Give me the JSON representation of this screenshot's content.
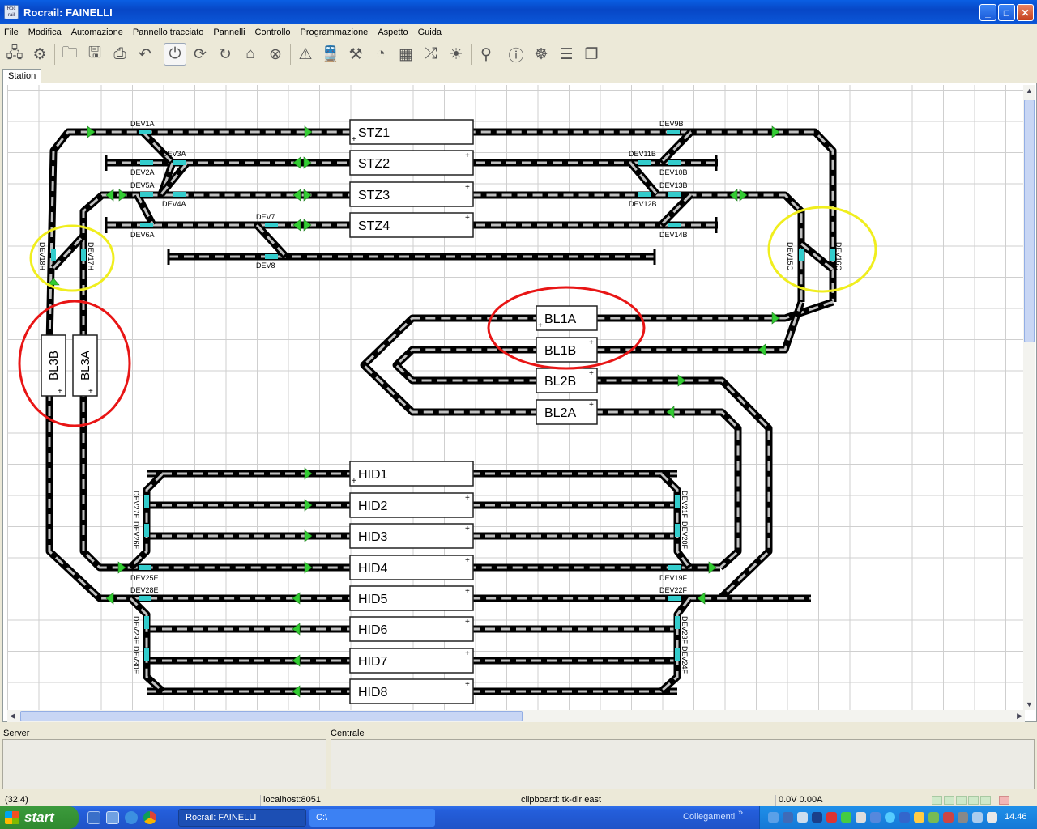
{
  "window": {
    "title": "Rocrail: FAINELLI",
    "app_icon_text": "Roc rail"
  },
  "menu": [
    "File",
    "Modifica",
    "Automazione",
    "Pannello tracciato",
    "Pannelli",
    "Controllo",
    "Programmazione",
    "Aspetto",
    "Guida"
  ],
  "toolbar": {
    "icons": [
      "server-icon",
      "gear-icon",
      "|",
      "open-folder-icon",
      "save-icon",
      "print-icon",
      "undo-icon",
      "|",
      "power-icon",
      "sync-icon",
      "rotate-icon",
      "home-icon",
      "stop-icon",
      "|",
      "warning-icon",
      "locomotive-icon",
      "tools-icon",
      "throttle-icon",
      "switchboard-icon",
      "shuffle-icon",
      "light-icon",
      "|",
      "search-icon",
      "|",
      "info-icon",
      "bug-icon",
      "list-icon",
      "pages-icon"
    ]
  },
  "tabs": [
    {
      "label": "Station"
    }
  ],
  "plan": {
    "stations": [
      "STZ1",
      "STZ2",
      "STZ3",
      "STZ4"
    ],
    "blocks": [
      "BL1A",
      "BL1B",
      "BL2B",
      "BL2A",
      "BL3B",
      "BL3A"
    ],
    "hidden": [
      "HID1",
      "HID2",
      "HID3",
      "HID4",
      "HID5",
      "HID6",
      "HID7",
      "HID8"
    ],
    "switches": [
      "DEV1A",
      "DEV3A",
      "DEV2A",
      "DEV5A",
      "DEV4A",
      "DEV6A",
      "DEV7",
      "DEV8",
      "DEV9B",
      "DEV11B",
      "DEV10B",
      "DEV13B",
      "DEV12B",
      "DEV14B",
      "DEV18H",
      "DEV17H",
      "DEV15C",
      "DEV16C",
      "DEV27E",
      "DEV26E",
      "DEV25E",
      "DEV28E",
      "DEV29E",
      "DEV30E",
      "DEV21F",
      "DEV20F",
      "DEV19F",
      "DEV22F",
      "DEV23F",
      "DEV24F"
    ],
    "colors": {
      "track": "#000000",
      "rail_dash": "#c0c0c0",
      "signal": "#33cc33",
      "switch": "#33cccc",
      "highlight_red": "#e81515",
      "highlight_yellow": "#f0ee1e"
    }
  },
  "panels": {
    "server_label": "Server",
    "central_label": "Centrale"
  },
  "status": {
    "coords": "(32,4)",
    "host": "localhost:8051",
    "clipboard": "clipboard: tk-dir east",
    "power": "0.0V 0.00A"
  },
  "taskbar": {
    "start": "start",
    "task_app": "Rocrail: FAINELLI",
    "task_cmd": "C:\\",
    "links": "Collegamenti",
    "clock": "14.46"
  }
}
